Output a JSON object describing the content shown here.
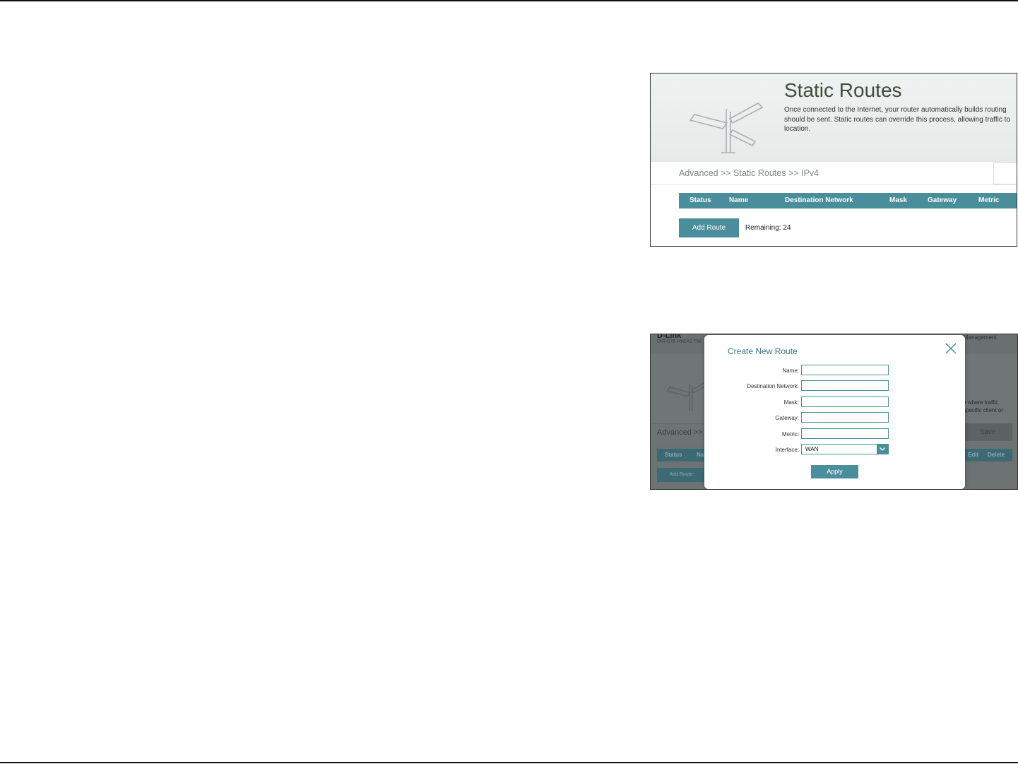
{
  "static_routes_page": {
    "title": "Static Routes",
    "description": "Once connected to the Internet, your router automatically builds routing\nshould be sent. Static routes can override this process, allowing traffic to\nlocation.",
    "breadcrumb": "Advanced >> Static Routes >> IPv4",
    "table_headers": [
      "Status",
      "Name",
      "Destination Network",
      "Mask",
      "Gateway",
      "Metric"
    ],
    "add_route_label": "Add Route",
    "remaining_text": "Remaining: 24"
  },
  "background_page": {
    "model_text": "DIR-878 HW:A1 FW",
    "management_text": "Management",
    "description_fragment": "e where traffic\nspecific client or",
    "breadcrumb_fragment": "Advanced >> S",
    "save_label": "Save",
    "table_headers_visible": [
      "Status",
      "Na",
      "Edit",
      "Delete"
    ],
    "add_route_label": "Add Route"
  },
  "create_route_modal": {
    "title": "Create New Route",
    "fields": [
      {
        "label": "Name:",
        "value": ""
      },
      {
        "label": "Destination Network:",
        "value": ""
      },
      {
        "label": "Mask:",
        "value": ""
      },
      {
        "label": "Gateway:",
        "value": ""
      },
      {
        "label": "Metric:",
        "value": ""
      }
    ],
    "interface_label": "Interface:",
    "interface_value": "WAN",
    "apply_label": "Apply"
  },
  "colors": {
    "accent": "#4a8e9c",
    "title_text": "#3f4d3a",
    "modal_title": "#3a7a8c"
  },
  "icons": [
    "signpost-icon",
    "close-icon",
    "chevron-down-icon"
  ]
}
